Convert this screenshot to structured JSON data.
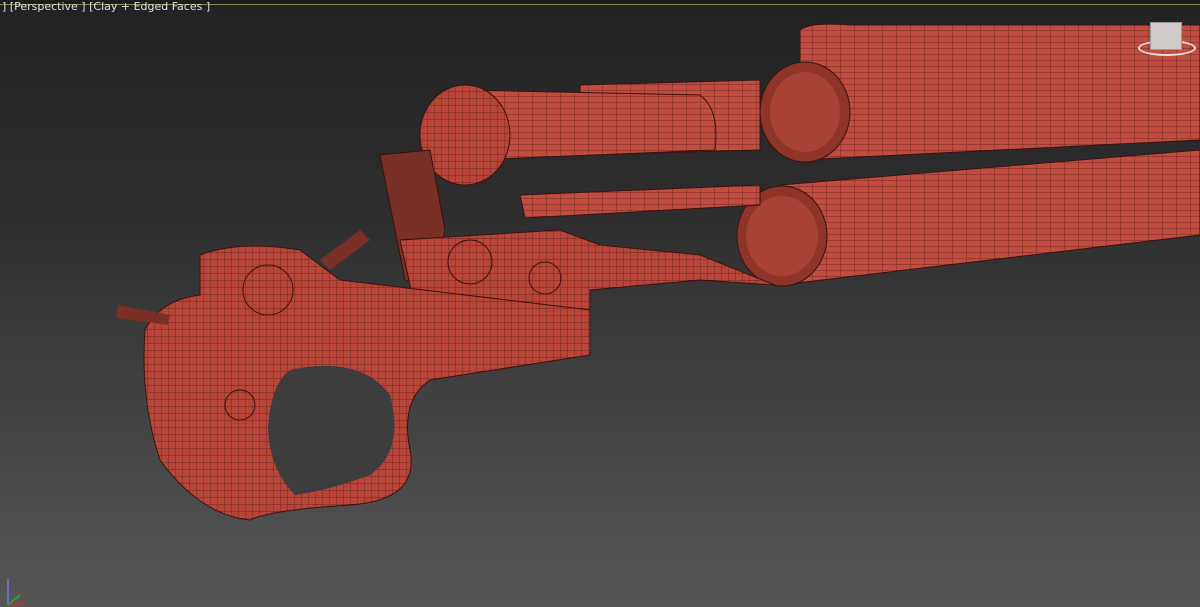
{
  "viewport": {
    "label_parts": [
      "] ",
      "[Perspective ] ",
      "[Clay + Edged Faces ]"
    ],
    "model_color": "#b8453a",
    "wire_color": "#5a1c16"
  }
}
